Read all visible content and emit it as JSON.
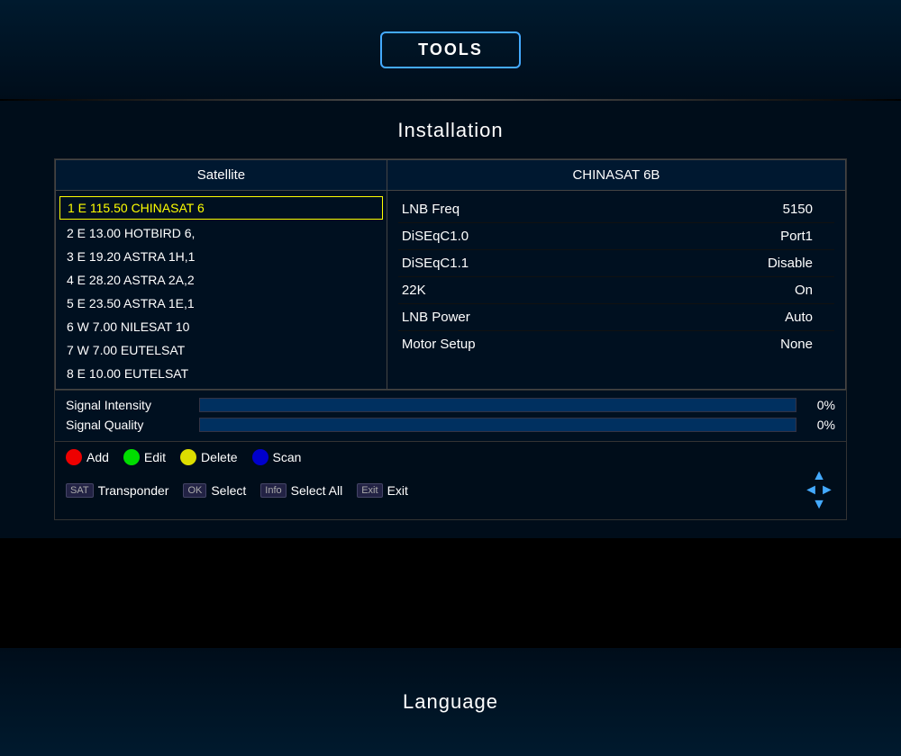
{
  "header": {
    "tools_label": "TOOLS"
  },
  "installation": {
    "title": "Installation",
    "satellite": {
      "header": "Satellite",
      "items": [
        {
          "id": 1,
          "direction": "E",
          "degrees": "115.50",
          "name": "CHINASAT 6",
          "selected": true
        },
        {
          "id": 2,
          "direction": "E",
          "degrees": "13.00",
          "name": "HOTBIRD 6,"
        },
        {
          "id": 3,
          "direction": "E",
          "degrees": "19.20",
          "name": "ASTRA 1H,1"
        },
        {
          "id": 4,
          "direction": "E",
          "degrees": "28.20",
          "name": "ASTRA 2A,2"
        },
        {
          "id": 5,
          "direction": "E",
          "degrees": "23.50",
          "name": "ASTRA 1E,1"
        },
        {
          "id": 6,
          "direction": "W",
          "degrees": "7.00",
          "name": "NILESAT 10"
        },
        {
          "id": 7,
          "direction": "W",
          "degrees": "7.00",
          "name": "EUTELSAT"
        },
        {
          "id": 8,
          "direction": "E",
          "degrees": "10.00",
          "name": "EUTELSAT"
        }
      ]
    },
    "settings": {
      "header": "CHINASAT 6B",
      "rows": [
        {
          "label": "LNB Freq",
          "value": "5150"
        },
        {
          "label": "DiSEqC1.0",
          "value": "Port1"
        },
        {
          "label": "DiSEqC1.1",
          "value": "Disable"
        },
        {
          "label": "22K",
          "value": "On"
        },
        {
          "label": "LNB Power",
          "value": "Auto"
        },
        {
          "label": "Motor Setup",
          "value": "None"
        }
      ]
    },
    "signal": {
      "intensity_label": "Signal Intensity",
      "intensity_percent": "0%",
      "intensity_value": 0,
      "quality_label": "Signal Quality",
      "quality_percent": "0%",
      "quality_value": 0
    },
    "buttons": {
      "row1": [
        {
          "color": "red",
          "label": "Add"
        },
        {
          "color": "green",
          "label": "Edit"
        },
        {
          "color": "yellow",
          "label": "Delete"
        },
        {
          "color": "blue",
          "label": "Scan"
        }
      ],
      "row2": [
        {
          "badge": "SAT",
          "label": "Transponder"
        },
        {
          "badge": "OK",
          "label": "Select"
        },
        {
          "badge": "Info",
          "label": "Select All"
        },
        {
          "badge": "Exit",
          "label": "Exit"
        }
      ]
    }
  },
  "footer": {
    "title": "Language"
  }
}
